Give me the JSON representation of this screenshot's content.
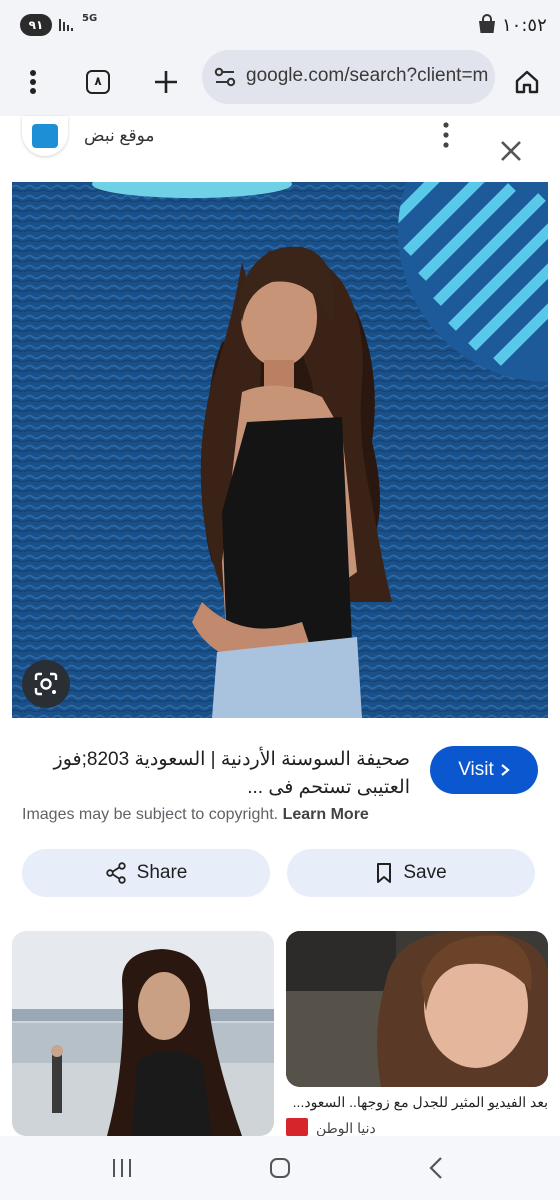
{
  "status_bar": {
    "battery": "٩١",
    "network_type": "5G",
    "time": "١٠:٥٢",
    "icons": [
      "signal-icon",
      "shopping-bag-icon"
    ]
  },
  "browser": {
    "tab_count": "٨",
    "url": "google.com/search?client=ms",
    "icons": [
      "menu-dots-icon",
      "tabs-icon",
      "new-tab-icon",
      "site-settings-icon",
      "home-icon"
    ]
  },
  "source": {
    "site_name": "موقع نبض",
    "icons": [
      "more-options-icon",
      "close-icon"
    ]
  },
  "result": {
    "title": "صحيفة السوسنة الأردنية | السعودية 8203;فوز العتيبى تستحم فى ...",
    "visit_label": "Visit",
    "copyright_text": "Images may be subject to copyright.",
    "learn_more": "Learn More",
    "share_label": "Share",
    "save_label": "Save"
  },
  "related": [
    {
      "caption": "",
      "source": ""
    },
    {
      "caption": "بعد الفيديو المثير للجدل مع زوجها.. السعود...",
      "source": "دنيا الوطن"
    }
  ],
  "nav": {
    "icons": [
      "recent-apps-icon",
      "home-button-icon",
      "back-icon"
    ]
  },
  "colors": {
    "accent": "#0b57d0",
    "pill": "#e8eef9",
    "toolbar": "#f3f4f8",
    "image_bg": "#1a4f86"
  }
}
